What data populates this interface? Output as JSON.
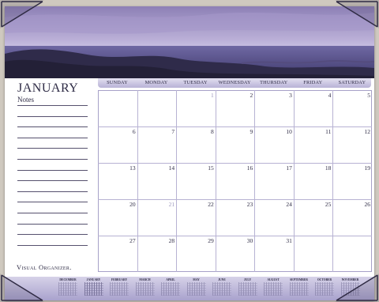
{
  "month": "JANUARY",
  "notes_label": "Notes",
  "brand": "Visual Organizer.",
  "weekdays": [
    "SUNDAY",
    "MONDAY",
    "TUESDAY",
    "WEDNESDAY",
    "THURSDAY",
    "FRIDAY",
    "SATURDAY"
  ],
  "weeks": [
    [
      "",
      "",
      "1",
      "2",
      "3",
      "4",
      "5"
    ],
    [
      "6",
      "7",
      "8",
      "9",
      "10",
      "11",
      "12"
    ],
    [
      "13",
      "14",
      "15",
      "16",
      "17",
      "18",
      "19"
    ],
    [
      "20",
      "21",
      "22",
      "23",
      "24",
      "25",
      "26"
    ],
    [
      "27",
      "28",
      "29",
      "30",
      "31",
      "",
      ""
    ]
  ],
  "mini_months": [
    "DECEMBER",
    "JANUARY",
    "FEBRUARY",
    "MARCH",
    "APRIL",
    "MAY",
    "JUNE",
    "JULY",
    "AUGUST",
    "SEPTEMBER",
    "OCTOBER",
    "NOVEMBER"
  ],
  "colors": {
    "accent": "#b8b2d6",
    "ink": "#2d2a44",
    "strip": "#a9a2cd",
    "sky": "#8e7fb8"
  }
}
